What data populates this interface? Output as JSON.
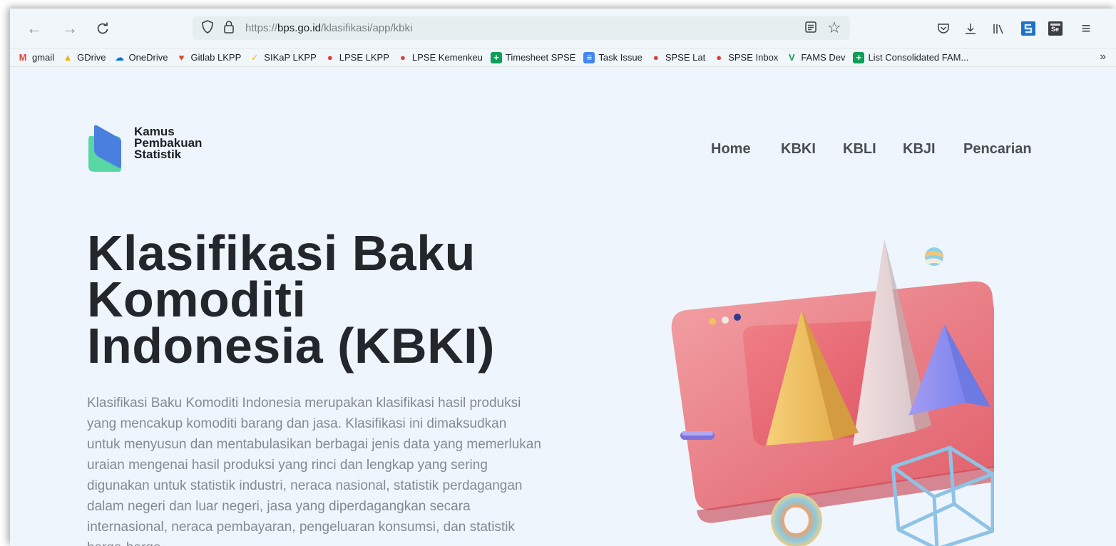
{
  "browser": {
    "url_prefix": "https://",
    "url_domain": "bps.go.id",
    "url_path": "/klasifikasi/app/kbki",
    "icons": [
      "back-icon",
      "forward-icon",
      "reload-icon",
      "shield-icon",
      "lock-icon",
      "reader-icon",
      "star-icon",
      "pocket-icon",
      "download-icon",
      "library-icon",
      "extension-s-icon",
      "extension-se-icon",
      "menu-icon"
    ],
    "extension_se_label": "Se"
  },
  "bookmarks": [
    {
      "label": "gmail",
      "icon": "M",
      "color": "#ea4335"
    },
    {
      "label": "GDrive",
      "icon": "▲",
      "color": "#f4b400"
    },
    {
      "label": "OneDrive",
      "icon": "☁",
      "color": "#0a6fd6"
    },
    {
      "label": "Gitlab LKPP",
      "icon": "♥",
      "color": "#e2432a"
    },
    {
      "label": "SIKaP LKPP",
      "icon": "✓",
      "color": "#f7b500"
    },
    {
      "label": "LPSE LKPP",
      "icon": "●",
      "color": "#e53935"
    },
    {
      "label": "LPSE Kemenkeu",
      "icon": "●",
      "color": "#e53935"
    },
    {
      "label": "Timesheet SPSE",
      "icon": "+",
      "color": "#0f9d58"
    },
    {
      "label": "Task Issue",
      "icon": "≡",
      "color": "#4285f4"
    },
    {
      "label": "SPSE Lat",
      "icon": "●",
      "color": "#e53935"
    },
    {
      "label": "SPSE Inbox",
      "icon": "●",
      "color": "#e53935"
    },
    {
      "label": "FAMS Dev",
      "icon": "V",
      "color": "#1b9e5a"
    },
    {
      "label": "List Consolidated FAM...",
      "icon": "+",
      "color": "#0f9d58"
    }
  ],
  "bookmarks_more": "»",
  "site": {
    "logo_lines": [
      "Kamus",
      "Pembakuan",
      "Statistik"
    ],
    "nav": [
      "Home",
      "KBKI",
      "KBLI",
      "KBJI",
      "Pencarian"
    ]
  },
  "hero": {
    "title_lines": [
      "Klasifikasi Baku",
      "Komoditi",
      "Indonesia (KBKI)"
    ],
    "description": "Klasifikasi Baku Komoditi Indonesia merupakan klasifikasi hasil produksi yang mencakup komoditi barang dan jasa. Klasifikasi ini dimaksudkan untuk menyusun dan mentabulasikan berbagai jenis data yang memerlukan uraian mengenai hasil produksi yang rinci dan lengkap yang sering digunakan untuk statistik industri, neraca nasional, statistik perdagangan dalam negeri dan luar negeri, jasa yang diperdagangkan secara internasional, neraca pembayaran, pengeluaran konsumsi, dan statistik harga-harga."
  },
  "colors": {
    "page_bg": "#eef5fc",
    "heading": "#23272c",
    "body_text": "#858a90",
    "nav_text": "#4a4d52",
    "logo_blue": "#4a7fe0",
    "logo_green": "#58d6a4"
  }
}
